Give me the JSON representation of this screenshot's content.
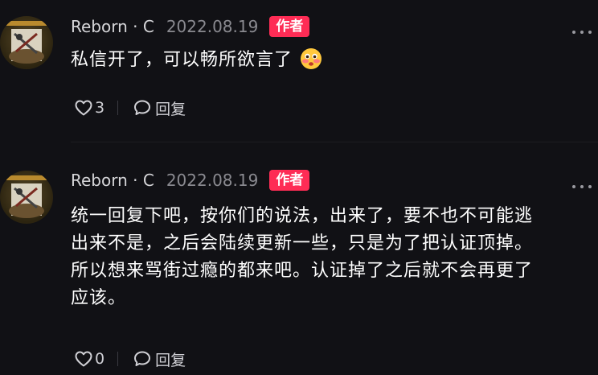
{
  "comments": [
    {
      "username": "Reborn · C",
      "date": "2022.08.19",
      "badge": "作者",
      "text": "私信开了，可以畅所欲言了",
      "emoji": "flushed-face-emoji",
      "likes": "3",
      "reply_label": "回复"
    },
    {
      "username": "Reborn · C",
      "date": "2022.08.19",
      "badge": "作者",
      "lines": [
        "统一回复下吧，按你们的说法，出来了，要不也不可能逃",
        "出来不是，之后会陆续更新一些，只是为了把认证顶掉。",
        "所以想来骂街过瘾的都来吧。认证掉了之后就不会再更了",
        "应该。"
      ],
      "likes": "0",
      "reply_label": "回复"
    }
  ],
  "colors": {
    "background": "#111115",
    "badge": "#fe2c55",
    "username": "#d6d6d9",
    "date": "#8a8a90"
  },
  "icons": [
    "heart-icon",
    "comment-bubble-icon",
    "more-dots-icon"
  ]
}
